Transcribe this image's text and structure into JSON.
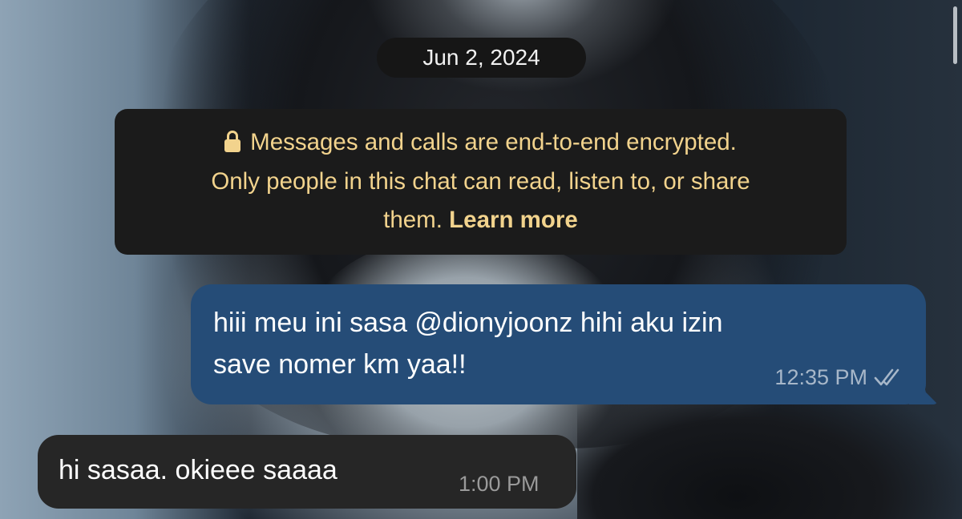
{
  "chat": {
    "date_separator": "Jun 2, 2024",
    "encryption_notice": {
      "line1": "Messages and calls are end-to-end encrypted.",
      "line2": "Only people in this chat can read, listen to, or share",
      "line3_prefix": "them. ",
      "learn_more": "Learn more",
      "icon": "lock-icon",
      "text_color": "#f2d38d"
    },
    "messages": [
      {
        "direction": "outgoing",
        "line1": "hiii meu ini sasa @dionyjoonz hihi aku izin",
        "line2": "save nomer km yaa!!",
        "time": "12:35 PM",
        "status_icon": "double-check-read-icon",
        "bubble_color": "#254c77"
      },
      {
        "direction": "incoming",
        "text": "hi sasaa. okieee saaaa",
        "time": "1:00 PM",
        "bubble_color": "#262626"
      }
    ]
  }
}
